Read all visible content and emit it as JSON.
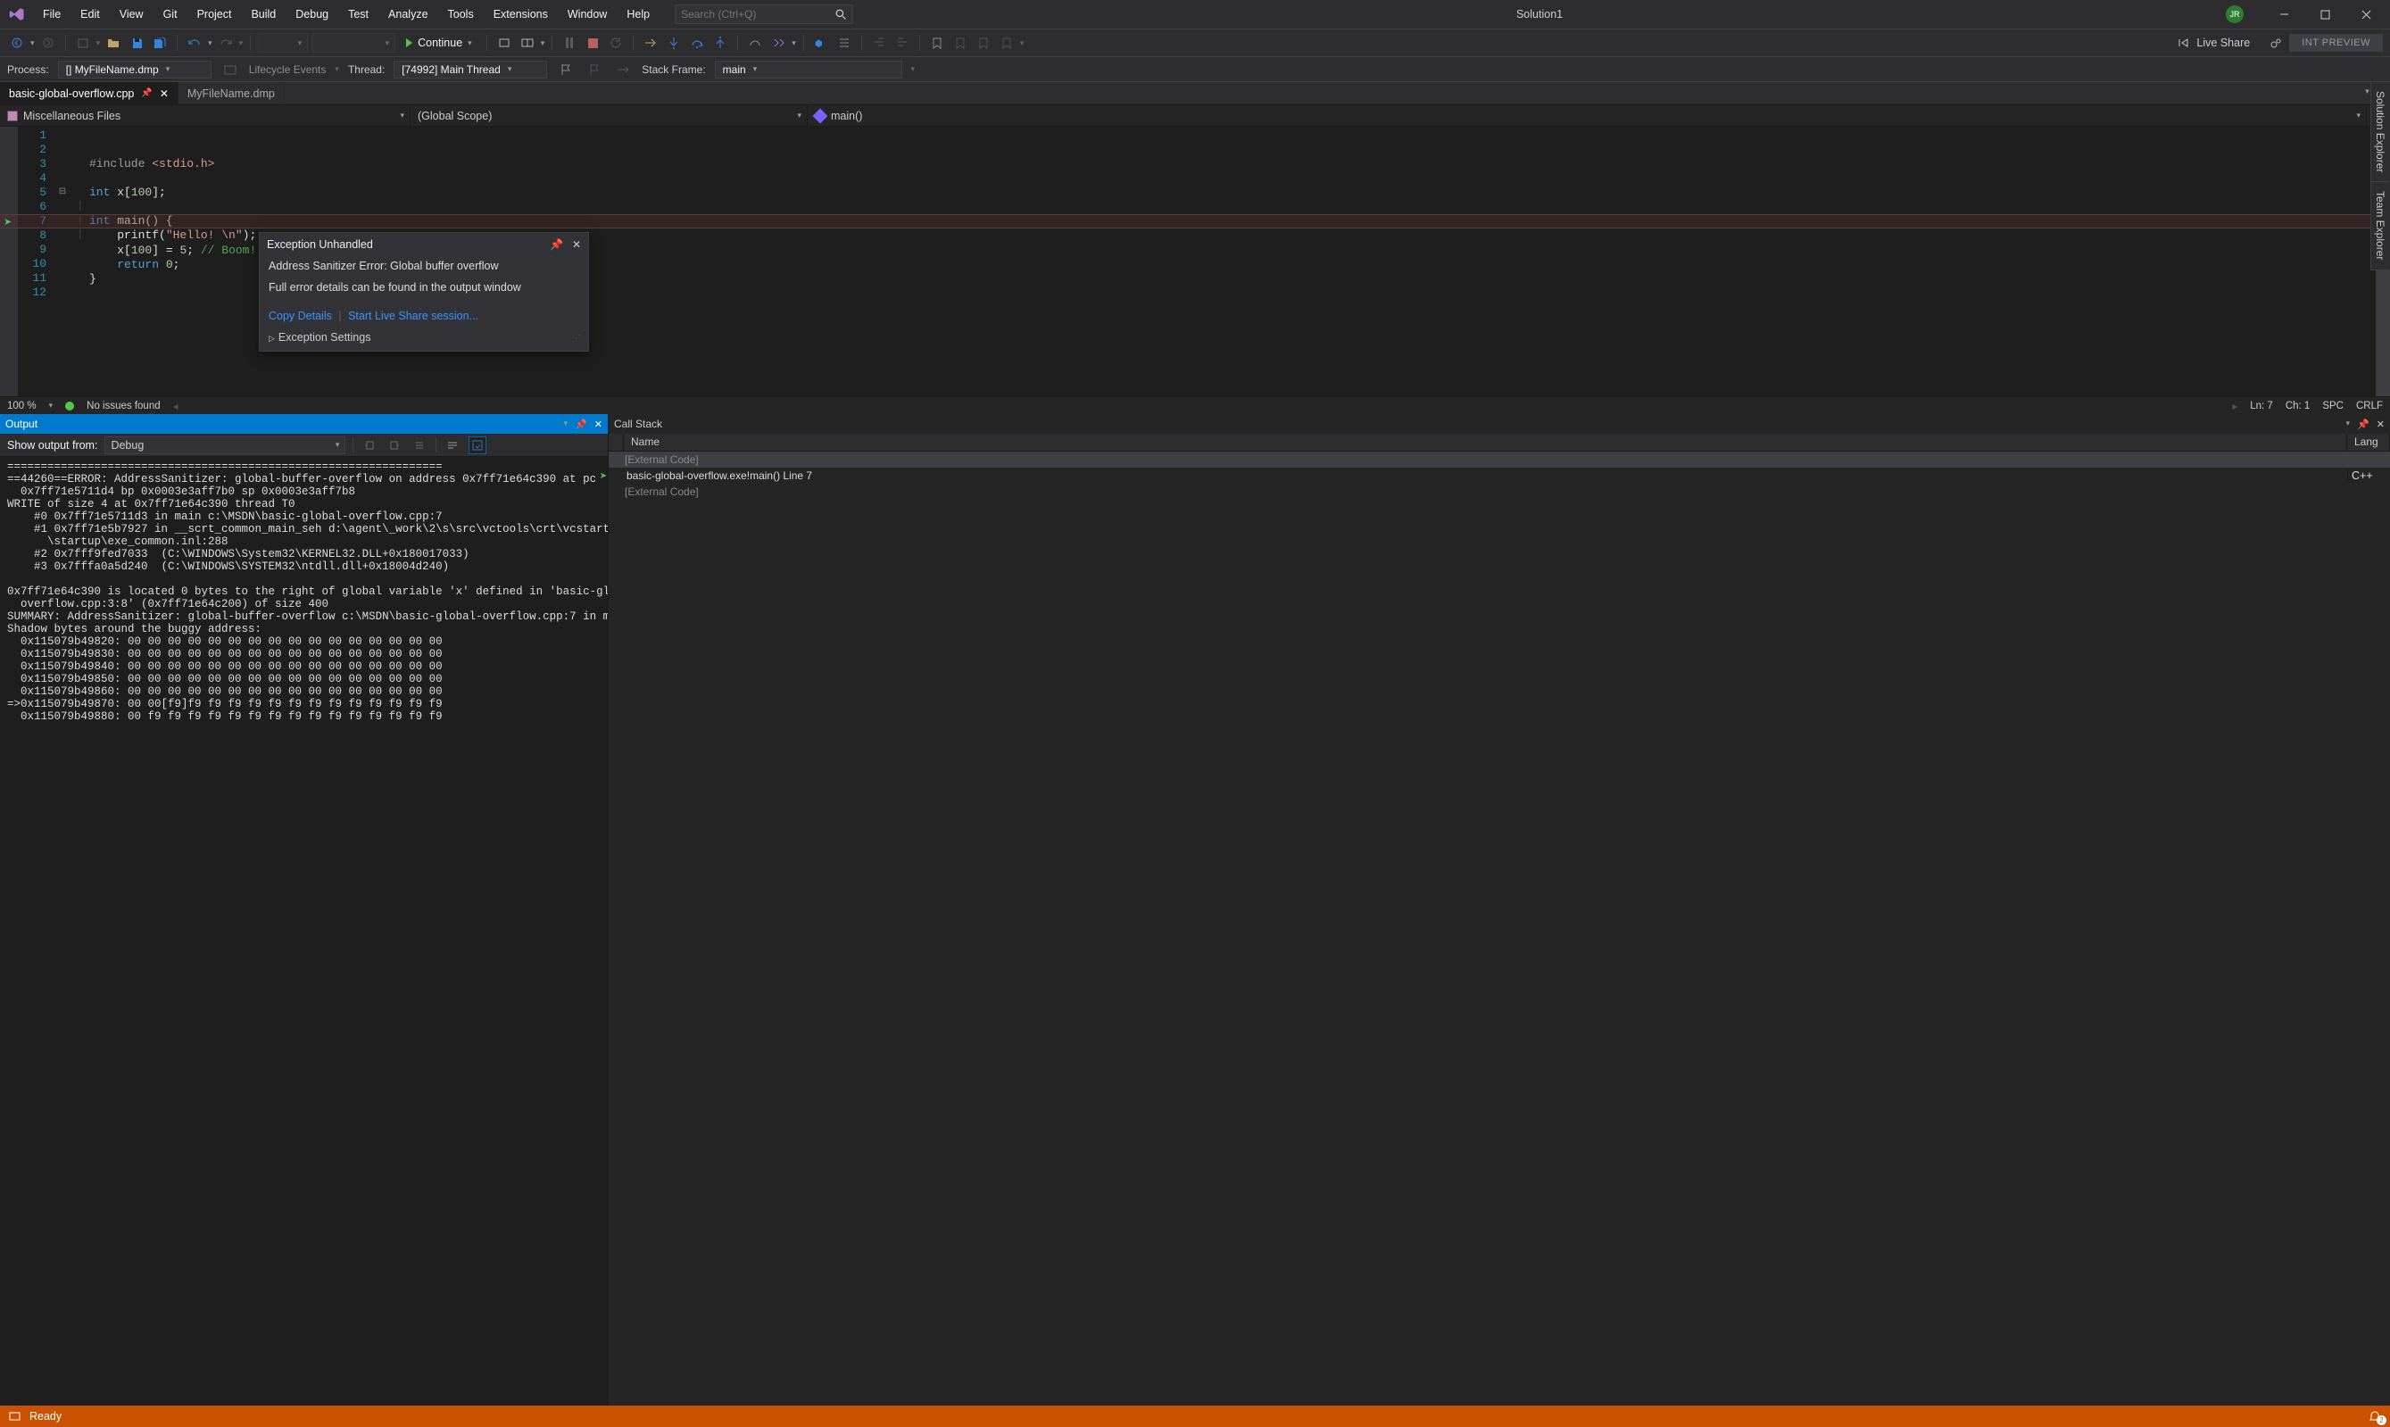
{
  "titlebar": {
    "menu": [
      "File",
      "Edit",
      "View",
      "Git",
      "Project",
      "Build",
      "Debug",
      "Test",
      "Analyze",
      "Tools",
      "Extensions",
      "Window",
      "Help"
    ],
    "search_placeholder": "Search (Ctrl+Q)",
    "solution": "Solution1",
    "user_initials": "JR"
  },
  "toolbar": {
    "continue_label": "Continue",
    "liveshare": "Live Share",
    "intpreview": "INT PREVIEW"
  },
  "debugbar": {
    "process_label": "Process:",
    "process_value": "[] MyFileName.dmp",
    "lifecycle_label": "Lifecycle Events",
    "thread_label": "Thread:",
    "thread_value": "[74992] Main Thread",
    "stackframe_label": "Stack Frame:",
    "stackframe_value": "main"
  },
  "filetabs": {
    "tabs": [
      {
        "name": "basic-global-overflow.cpp",
        "active": true,
        "pinned": true
      },
      {
        "name": "MyFileName.dmp",
        "active": false,
        "pinned": false
      }
    ]
  },
  "navrow": {
    "c0": "Miscellaneous Files",
    "c1": "(Global Scope)",
    "c2": "main()"
  },
  "editor": {
    "line_numbers": [
      "1",
      "2",
      "3",
      "4",
      "5",
      "6",
      "7",
      "8",
      "9",
      "10",
      "11",
      "12"
    ],
    "zoom": "100 %",
    "issues": "No issues found",
    "ln": "Ln: 7",
    "ch": "Ch: 1",
    "spc": "SPC",
    "crlf": "CRLF"
  },
  "exception": {
    "title": "Exception Unhandled",
    "msg1": "Address Sanitizer Error: Global buffer overflow",
    "msg2": "Full error details can be found in the output window",
    "link1": "Copy Details",
    "link2": "Start Live Share session...",
    "settings": "Exception Settings"
  },
  "output": {
    "title": "Output",
    "show_label": "Show output from:",
    "show_value": "Debug",
    "text": "=================================================================\n==44260==ERROR: AddressSanitizer: global-buffer-overflow on address 0x7ff71e64c390 at pc\n  0x7ff71e5711d4 bp 0x0003e3aff7b0 sp 0x0003e3aff7b8\nWRITE of size 4 at 0x7ff71e64c390 thread T0\n    #0 0x7ff71e5711d3 in main c:\\MSDN\\basic-global-overflow.cpp:7\n    #1 0x7ff71e5b7927 in __scrt_common_main_seh d:\\agent\\_work\\2\\s\\src\\vctools\\crt\\vcstartup\\src\n      \\startup\\exe_common.inl:288\n    #2 0x7fff9fed7033  (C:\\WINDOWS\\System32\\KERNEL32.DLL+0x180017033)\n    #3 0x7fffa0a5d240  (C:\\WINDOWS\\SYSTEM32\\ntdll.dll+0x18004d240)\n\n0x7ff71e64c390 is located 0 bytes to the right of global variable 'x' defined in 'basic-global-\n  overflow.cpp:3:8' (0x7ff71e64c200) of size 400\nSUMMARY: AddressSanitizer: global-buffer-overflow c:\\MSDN\\basic-global-overflow.cpp:7 in main\nShadow bytes around the buggy address:\n  0x115079b49820: 00 00 00 00 00 00 00 00 00 00 00 00 00 00 00 00\n  0x115079b49830: 00 00 00 00 00 00 00 00 00 00 00 00 00 00 00 00\n  0x115079b49840: 00 00 00 00 00 00 00 00 00 00 00 00 00 00 00 00\n  0x115079b49850: 00 00 00 00 00 00 00 00 00 00 00 00 00 00 00 00\n  0x115079b49860: 00 00 00 00 00 00 00 00 00 00 00 00 00 00 00 00\n=>0x115079b49870: 00 00[f9]f9 f9 f9 f9 f9 f9 f9 f9 f9 f9 f9 f9 f9\n  0x115079b49880: 00 f9 f9 f9 f9 f9 f9 f9 f9 f9 f9 f9 f9 f9 f9 f9"
  },
  "callstack": {
    "title": "Call Stack",
    "col_name": "Name",
    "col_lang": "Lang",
    "rows": [
      {
        "name": "[External Code]",
        "lang": "",
        "dim": true,
        "sel": true,
        "arrow": false
      },
      {
        "name": "basic-global-overflow.exe!main() Line 7",
        "lang": "C++",
        "dim": false,
        "sel": false,
        "arrow": true
      },
      {
        "name": "[External Code]",
        "lang": "",
        "dim": true,
        "sel": false,
        "arrow": false
      }
    ]
  },
  "side_tabs": [
    "Solution Explorer",
    "Team Explorer"
  ],
  "statusbar": {
    "ready": "Ready"
  }
}
